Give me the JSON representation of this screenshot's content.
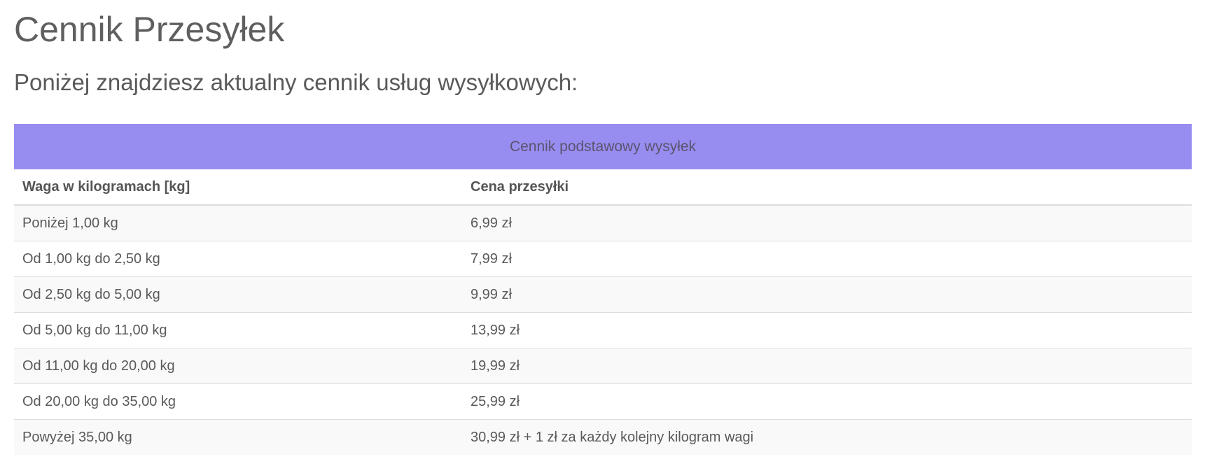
{
  "page": {
    "title": "Cennik Przesyłek",
    "subtitle": "Poniżej znajdziesz aktualny cennik usług wysyłkowych:"
  },
  "table": {
    "caption": "Cennik podstawowy wysyłek",
    "headers": [
      "Waga w kilogramach [kg]",
      "Cena przesyłki"
    ],
    "rows": [
      [
        "Poniżej 1,00 kg",
        "6,99 zł"
      ],
      [
        "Od 1,00 kg do 2,50 kg",
        "7,99 zł"
      ],
      [
        "Od 2,50 kg do 5,00 kg",
        "9,99 zł"
      ],
      [
        "Od 5,00 kg do 11,00 kg",
        "13,99 zł"
      ],
      [
        "Od 11,00 kg do 20,00 kg",
        "19,99 zł"
      ],
      [
        "Od 20,00 kg do 35,00 kg",
        "25,99 zł"
      ],
      [
        "Powyżej 35,00 kg",
        "30,99 zł + 1 zł za każdy kolejny kilogram wagi"
      ]
    ]
  },
  "colors": {
    "caption_bg": "#978df0",
    "text": "#555555",
    "row_stripe": "#f9f9f9",
    "border": "#dddddd"
  }
}
